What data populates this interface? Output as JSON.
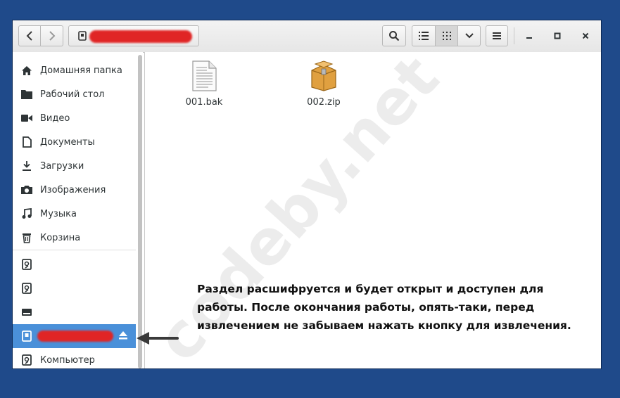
{
  "window": {
    "toolbar": {
      "back_icon": "go-back-icon",
      "forward_icon": "go-forward-icon",
      "location_icon": "drive-icon",
      "search_icon": "search-icon",
      "list_view_icon": "list-view-icon",
      "grid_view_icon": "grid-view-icon",
      "view_options_icon": "chevron-down-icon",
      "menu_icon": "menu-icon",
      "minimize_icon": "minimize-icon",
      "maximize_icon": "maximize-icon",
      "close_icon": "close-icon"
    },
    "sidebar": {
      "places": [
        {
          "label": "Домашняя папка",
          "icon": "home-icon"
        },
        {
          "label": "Рабочий стол",
          "icon": "desktop-folder-icon"
        },
        {
          "label": "Видео",
          "icon": "video-icon"
        },
        {
          "label": "Документы",
          "icon": "document-icon"
        },
        {
          "label": "Загрузки",
          "icon": "download-icon"
        },
        {
          "label": "Изображения",
          "icon": "camera-icon"
        },
        {
          "label": "Музыка",
          "icon": "music-icon"
        },
        {
          "label": "Корзина",
          "icon": "trash-icon"
        }
      ],
      "devices": [
        {
          "label": "",
          "icon": "drive-icon"
        },
        {
          "label": "",
          "icon": "drive-icon"
        },
        {
          "label": "",
          "icon": "disk-icon"
        },
        {
          "label": "",
          "icon": "drive-icon",
          "selected": true,
          "eject_icon": "eject-icon"
        },
        {
          "label": "Компьютер",
          "icon": "drive-icon"
        }
      ]
    },
    "files": [
      {
        "name": "001.bak",
        "icon": "text-file-icon"
      },
      {
        "name": "002.zip",
        "icon": "archive-icon"
      }
    ]
  },
  "overlay": {
    "watermark": "codeby.net",
    "annotation_lines": [
      "Раздел расшифруется и будет открыт и доступен для",
      "работы. После окончания работы, опять-таки, перед",
      "извлечением не забываем нажать кнопку для извлечения."
    ]
  },
  "colors": {
    "desktop": "#1f4a8a",
    "selection": "#4a90d9",
    "redaction": "#e02525"
  }
}
